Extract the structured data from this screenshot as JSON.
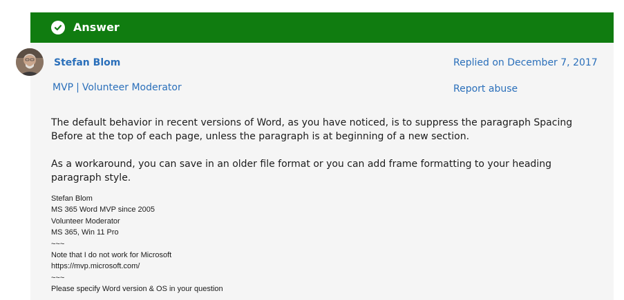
{
  "header": {
    "label": "Answer"
  },
  "post": {
    "author": "Stefan Blom",
    "roles": [
      "MVP",
      "Volunteer Moderator"
    ],
    "role_separator": "|",
    "replied": "Replied on December 7, 2017",
    "report": "Report abuse",
    "paragraphs": [
      "The default behavior in recent versions of Word, as you have noticed, is to suppress the paragraph Spacing Before at the top of each page, unless the paragraph is at beginning of a new section.",
      "As a workaround, you can save in an older file format or you can add frame formatting to your heading paragraph style."
    ],
    "signature": [
      "Stefan Blom",
      "MS 365 Word MVP since 2005",
      "Volunteer Moderator",
      "MS 365, Win 11 Pro",
      "~~~",
      "Note that I do not work for Microsoft",
      "https://mvp.microsoft.com/",
      "~~~",
      "Please specify Word version & OS in your question"
    ]
  },
  "colors": {
    "answer_bar": "#107c10",
    "link": "#2a6fba",
    "card_bg": "#f5f5f5"
  },
  "icons": {
    "answer": "checkmark-circle-icon",
    "avatar": "user-avatar"
  }
}
